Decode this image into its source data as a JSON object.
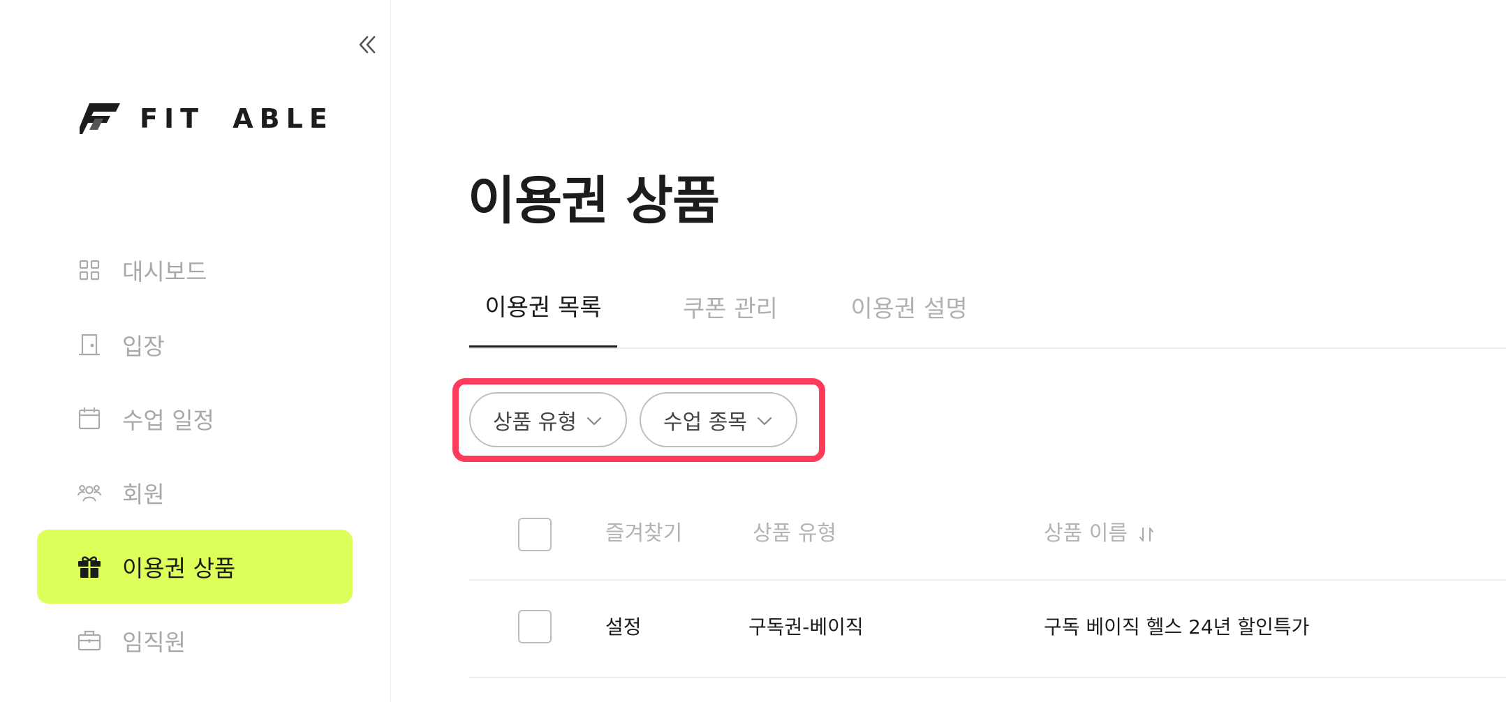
{
  "brand": {
    "name": "FIT ABLE"
  },
  "sidebar": {
    "collapse_icon": "double-chevron-left-icon",
    "items": [
      {
        "label": "대시보드",
        "icon": "grid-icon",
        "active": false
      },
      {
        "label": "입장",
        "icon": "door-icon",
        "active": false
      },
      {
        "label": "수업 일정",
        "icon": "calendar-icon",
        "active": false
      },
      {
        "label": "회원",
        "icon": "members-icon",
        "active": false
      },
      {
        "label": "이용권 상품",
        "icon": "gift-icon",
        "active": true
      },
      {
        "label": "임직원",
        "icon": "briefcase-icon",
        "active": false
      }
    ]
  },
  "main": {
    "title": "이용권 상품",
    "tabs": [
      {
        "label": "이용권 목록",
        "active": true
      },
      {
        "label": "쿠폰 관리",
        "active": false
      },
      {
        "label": "이용권 설명",
        "active": false
      }
    ],
    "filters": [
      {
        "label": "상품 유형",
        "icon": "chevron-down-icon"
      },
      {
        "label": "수업 종목",
        "icon": "chevron-down-icon"
      }
    ],
    "highlight_color": "#ff3b5c",
    "table": {
      "headers": [
        "즐겨찾기",
        "상품 유형",
        "상품 이름"
      ],
      "sort_icon": "sort-arrows-icon",
      "rows": [
        {
          "favorite": "설정",
          "type": "구독권-베이직",
          "name": "구독 베이직 헬스 24년 할인특가"
        }
      ]
    }
  },
  "colors": {
    "accent": "#ddff5a",
    "text": "#1c1c1c",
    "muted": "#a8a8a8",
    "border": "#ececec"
  }
}
